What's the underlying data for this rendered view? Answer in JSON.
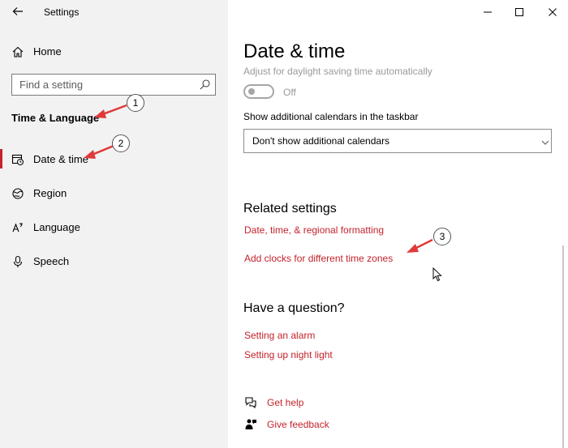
{
  "window": {
    "title": "Settings",
    "controls": {
      "minimize": "minimize-icon",
      "maximize": "maximize-icon",
      "close": "close-icon"
    }
  },
  "sidebar": {
    "home": {
      "label": "Home",
      "icon": "home-icon"
    },
    "search": {
      "placeholder": "Find a setting",
      "icon": "search-icon"
    },
    "section_title": "Time & Language",
    "items": [
      {
        "label": "Date & time",
        "icon": "calendar-clock-icon",
        "selected": true
      },
      {
        "label": "Region",
        "icon": "globe-icon",
        "selected": false
      },
      {
        "label": "Language",
        "icon": "language-icon",
        "selected": false
      },
      {
        "label": "Speech",
        "icon": "microphone-icon",
        "selected": false
      }
    ]
  },
  "main": {
    "title": "Date & time",
    "daylight_label": "Adjust for daylight saving time automatically",
    "daylight_toggle": {
      "state": "Off"
    },
    "calendars_label": "Show additional calendars in the taskbar",
    "calendars_dropdown": {
      "value": "Don't show additional calendars"
    },
    "related": {
      "heading": "Related settings",
      "links": [
        "Date, time, & regional formatting",
        "Add clocks for different time zones"
      ]
    },
    "question": {
      "heading": "Have a question?",
      "links": [
        "Setting an alarm",
        "Setting up night light"
      ]
    },
    "help": {
      "get_help": "Get help",
      "feedback": "Give feedback"
    }
  },
  "annotations": [
    "1",
    "2",
    "3"
  ],
  "colors": {
    "accent": "#c4232b",
    "sidebar_bg": "#f2f2f2",
    "annotation_arrow": "#e03a3a"
  }
}
